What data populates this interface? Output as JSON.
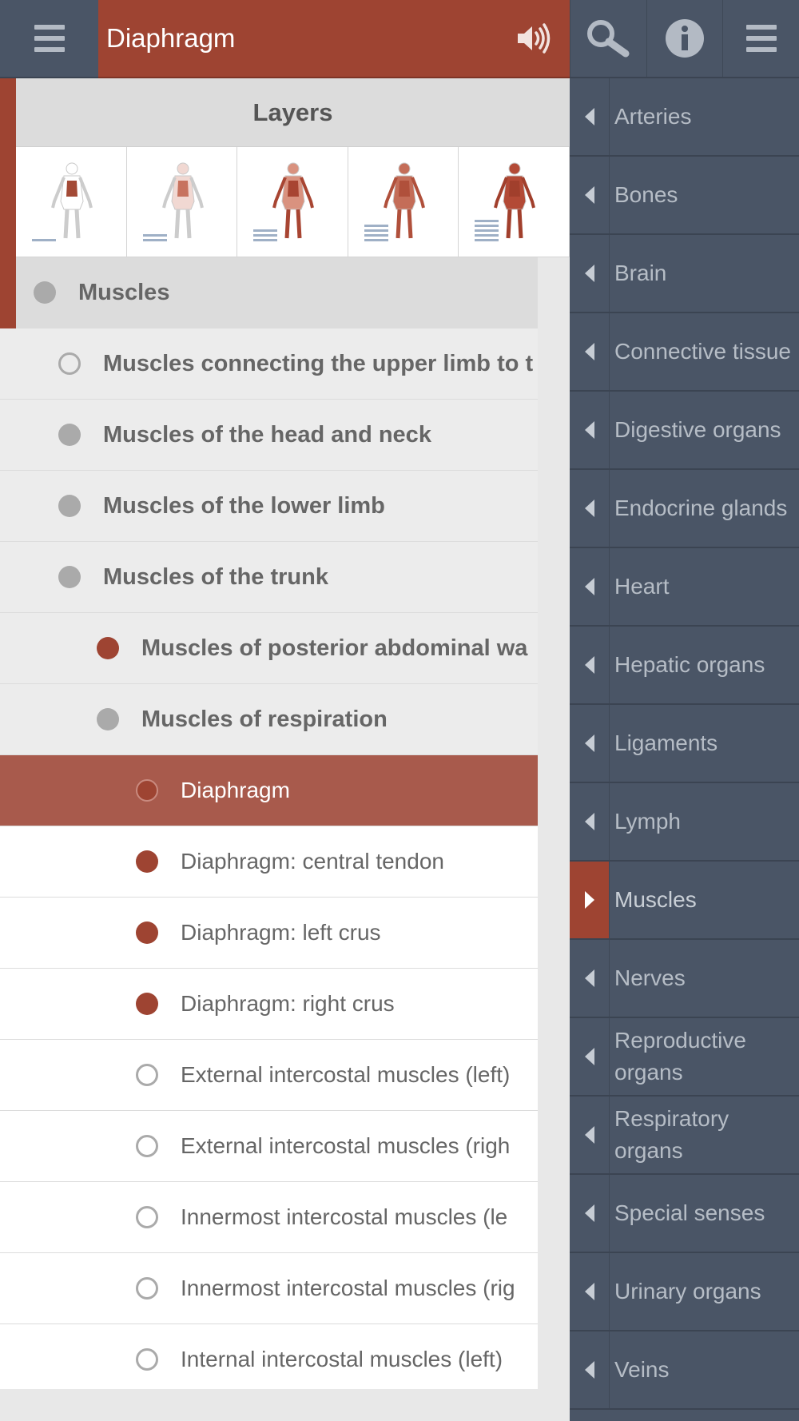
{
  "header": {
    "title": "Diaphragm",
    "left_menu_icon": "hamburger-icon",
    "sound_icon": "speaker-icon",
    "search_icon": "search-icon",
    "info_icon": "info-icon",
    "right_menu_icon": "hamburger-icon"
  },
  "layers": {
    "title": "Layers",
    "thumbnails": [
      {
        "level": 1
      },
      {
        "level": 2
      },
      {
        "level": 3
      },
      {
        "level": 4
      },
      {
        "level": 5
      }
    ]
  },
  "tree": {
    "root": {
      "label": "Muscles",
      "state": "grey"
    },
    "groups": [
      {
        "label": "Muscles connecting the upper limb to t",
        "state": "open"
      },
      {
        "label": "Muscles of the head and neck",
        "state": "grey"
      },
      {
        "label": "Muscles of the lower limb",
        "state": "grey"
      },
      {
        "label": "Muscles of the trunk",
        "state": "grey"
      }
    ],
    "subgroups": [
      {
        "label": "Muscles of posterior abdominal wa",
        "state": "red"
      },
      {
        "label": "Muscles of respiration",
        "state": "grey"
      }
    ],
    "items": [
      {
        "label": "Diaphragm",
        "state": "selected"
      },
      {
        "label": "Diaphragm: central tendon",
        "state": "red"
      },
      {
        "label": "Diaphragm: left crus",
        "state": "red"
      },
      {
        "label": "Diaphragm: right crus",
        "state": "red"
      },
      {
        "label": "External intercostal muscles (left)",
        "state": "open"
      },
      {
        "label": "External intercostal muscles (righ",
        "state": "open"
      },
      {
        "label": "Innermost intercostal muscles (le",
        "state": "open"
      },
      {
        "label": "Innermost intercostal muscles (rig",
        "state": "open"
      },
      {
        "label": "Internal intercostal muscles (left)",
        "state": "open"
      }
    ]
  },
  "nav": {
    "items": [
      {
        "label": "Arteries"
      },
      {
        "label": "Bones"
      },
      {
        "label": "Brain"
      },
      {
        "label": "Connective tissue"
      },
      {
        "label": "Digestive organs"
      },
      {
        "label": "Endocrine glands"
      },
      {
        "label": "Heart"
      },
      {
        "label": "Hepatic organs"
      },
      {
        "label": "Ligaments"
      },
      {
        "label": "Lymph"
      },
      {
        "label": "Muscles",
        "active": true
      },
      {
        "label": "Nerves"
      },
      {
        "label": "Reproductive organs"
      },
      {
        "label": "Respiratory organs"
      },
      {
        "label": "Special senses"
      },
      {
        "label": "Urinary organs"
      },
      {
        "label": "Veins"
      }
    ]
  },
  "colors": {
    "accent": "#9e4432",
    "selected_row": "#a85a4c",
    "nav_bg": "#4a5566",
    "nav_text": "#b6bdc6"
  }
}
